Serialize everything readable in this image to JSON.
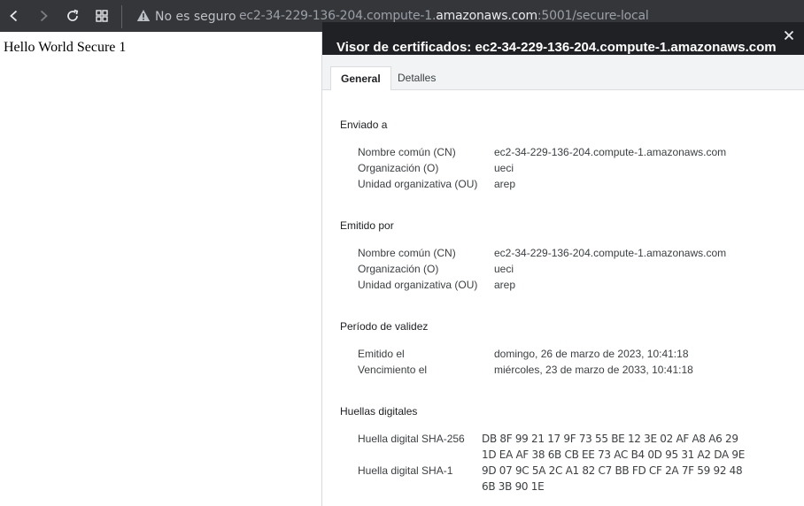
{
  "browser": {
    "security_label": "No es seguro",
    "url_prefix": "ec2-34-229-136-204.compute-1.",
    "url_domain": "amazonaws.com",
    "url_suffix": ":5001/secure-local"
  },
  "page": {
    "text": "Hello World Secure 1"
  },
  "viewer": {
    "title": "Visor de certificados: ec2-34-229-136-204.compute-1.amazonaws.com",
    "close_symbol": "×",
    "tabs": [
      {
        "label": "General",
        "active": true
      },
      {
        "label": "Detalles",
        "active": false
      }
    ],
    "issued_to": {
      "title": "Enviado a",
      "rows": [
        {
          "label": "Nombre común (CN)",
          "value": "ec2-34-229-136-204.compute-1.amazonaws.com"
        },
        {
          "label": "Organización (O)",
          "value": "ueci"
        },
        {
          "label": "Unidad organizativa (OU)",
          "value": "arep"
        }
      ]
    },
    "issued_by": {
      "title": "Emitido por",
      "rows": [
        {
          "label": "Nombre común (CN)",
          "value": "ec2-34-229-136-204.compute-1.amazonaws.com"
        },
        {
          "label": "Organización (O)",
          "value": "ueci"
        },
        {
          "label": "Unidad organizativa (OU)",
          "value": "arep"
        }
      ]
    },
    "validity": {
      "title": "Período de validez",
      "rows": [
        {
          "label": "Emitido el",
          "value": "domingo, 26 de marzo de 2023, 10:41:18"
        },
        {
          "label": "Vencimiento el",
          "value": "miércoles, 23 de marzo de 2033, 10:41:18"
        }
      ]
    },
    "fingerprints": {
      "title": "Huellas digitales",
      "sha256_label": "Huella digital SHA-256",
      "sha256_line1": "DB 8F 99 21 17 9F 73 55 BE 12 3E 02 AF A8 A6 29",
      "sha256_line2": "1D EA AF 38 6B CB EE 73 AC B4 0D 95 31 A2 DA 9E",
      "sha1_label": "Huella digital SHA-1",
      "sha1_line1": "9D 07 9C 5A 2C A1 82 C7 BB FD CF 2A 7F 59 92 48",
      "sha1_line2": "6B 3B 90 1E"
    }
  }
}
